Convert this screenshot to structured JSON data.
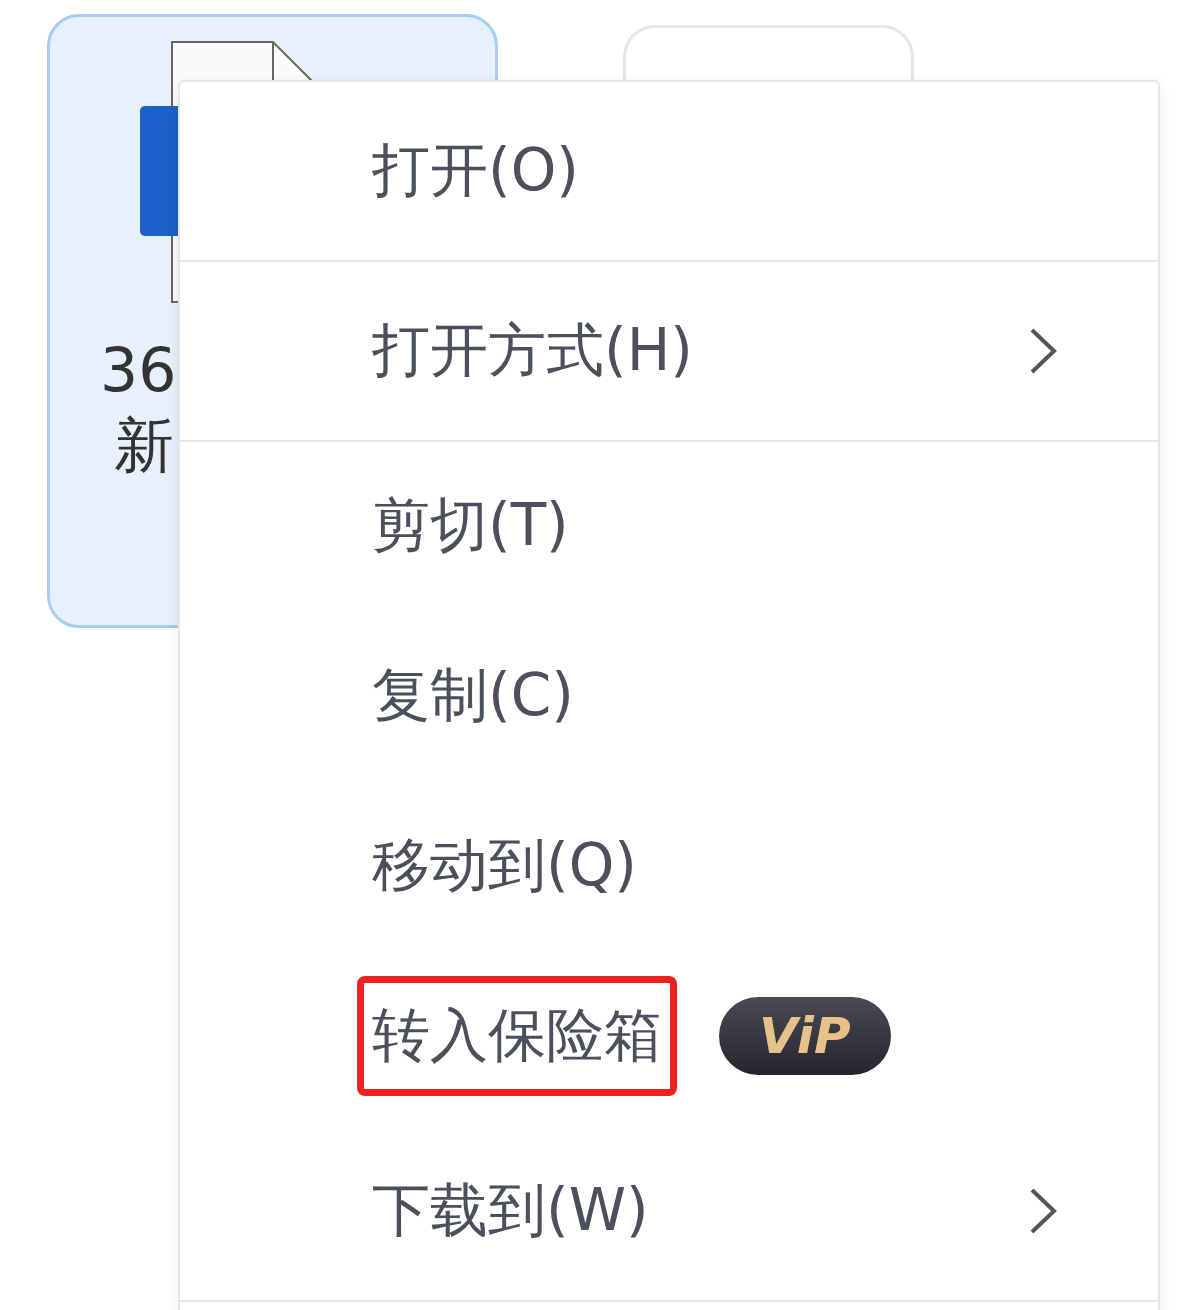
{
  "files": [
    {
      "name_lines": [
        "36",
        "新"
      ],
      "selected": true
    },
    {
      "selected": false
    }
  ],
  "context_menu": {
    "items": [
      {
        "label": "打开(O)",
        "kind": "item",
        "divider_after": true
      },
      {
        "label": "打开方式(H)",
        "kind": "submenu",
        "divider_after": true
      },
      {
        "label": "剪切(T)",
        "kind": "item",
        "divider_after": false
      },
      {
        "label": "复制(C)",
        "kind": "item",
        "divider_after": false
      },
      {
        "label": "移动到(Q)",
        "kind": "item",
        "divider_after": false
      },
      {
        "label": "转入保险箱",
        "kind": "item",
        "divider_after": false,
        "highlighted": true,
        "badge": "ViP"
      },
      {
        "label": "下载到(W)",
        "kind": "submenu",
        "divider_after": true
      }
    ]
  }
}
